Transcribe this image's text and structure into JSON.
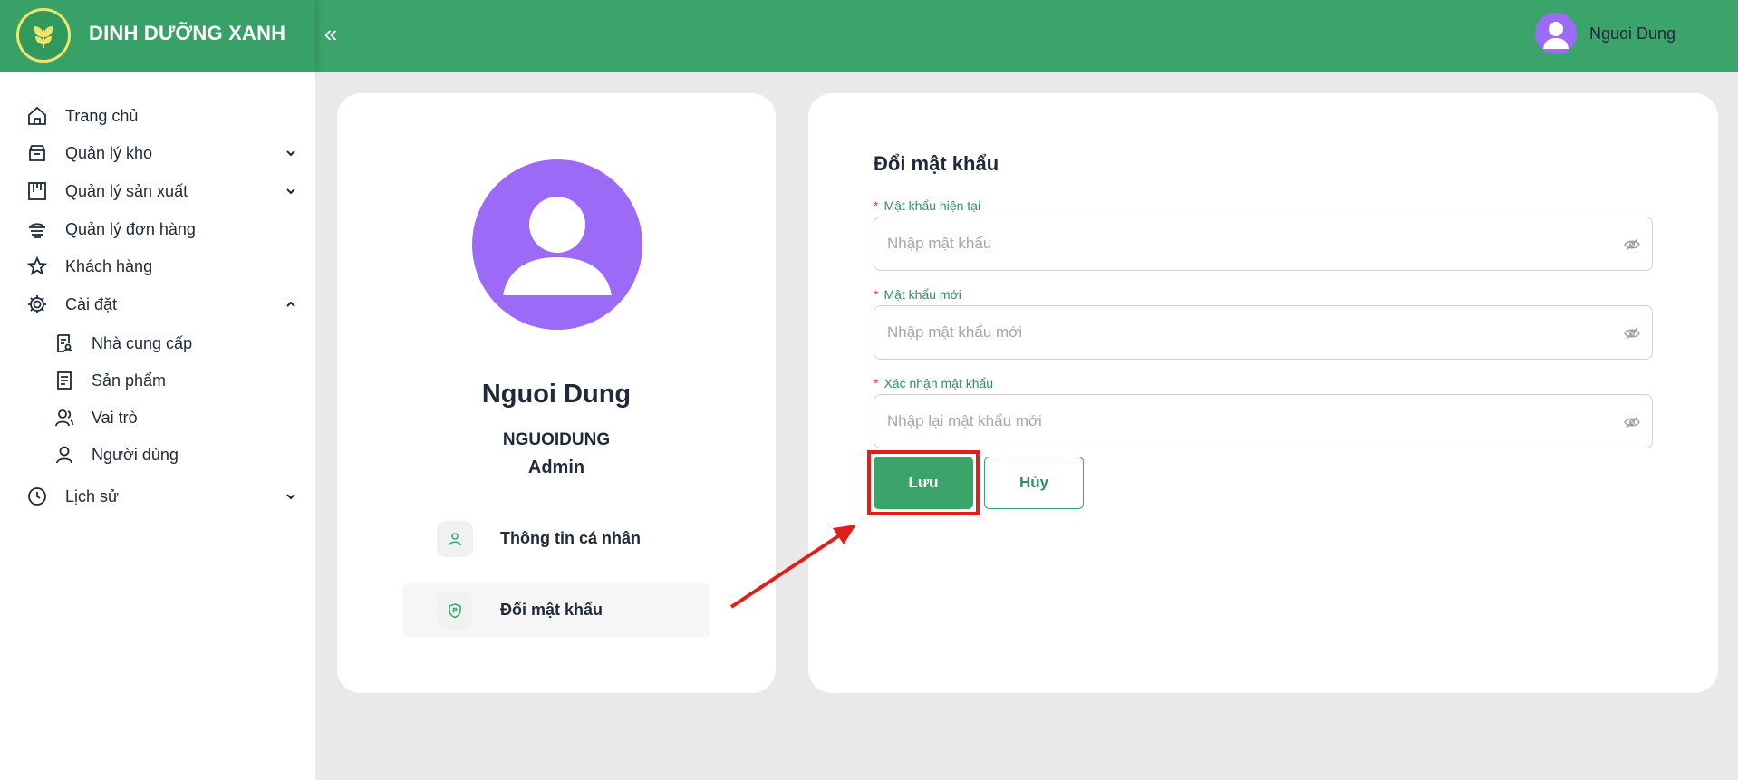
{
  "header": {
    "brand_name": "DINH DƯỠNG XANH",
    "collapse_glyph": "«",
    "user_name": "Nguoi Dung",
    "bg_color": "#3aa46a"
  },
  "sidebar": {
    "items": [
      {
        "label": "Trang chủ",
        "icon": "home-icon"
      },
      {
        "label": "Quản lý kho",
        "icon": "inventory-icon",
        "expanded": false
      },
      {
        "label": "Quản lý sản xuất",
        "icon": "production-icon",
        "expanded": false
      },
      {
        "label": "Quản lý đơn hàng",
        "icon": "orders-icon"
      },
      {
        "label": "Khách hàng",
        "icon": "star-icon"
      },
      {
        "label": "Cài đặt",
        "icon": "gear-icon",
        "expanded": true
      },
      {
        "label": "Nhà cung cấp",
        "icon": "supplier-icon"
      },
      {
        "label": "Sản phẩm",
        "icon": "product-icon"
      },
      {
        "label": "Vai trò",
        "icon": "role-icon"
      },
      {
        "label": "Người dùng",
        "icon": "user-icon"
      },
      {
        "label": "Lịch sử",
        "icon": "history-icon",
        "expanded": false
      }
    ]
  },
  "profile": {
    "display_name": "Nguoi Dung",
    "username": "NGUOIDUNG",
    "role": "Admin",
    "menu": [
      {
        "label": "Thông tin cá nhân",
        "icon": "person-icon",
        "active": false
      },
      {
        "label": "Đổi mật khẩu",
        "icon": "shield-icon",
        "active": true
      }
    ]
  },
  "change_password": {
    "title": "Đổi mật khẩu",
    "required_mark": "*",
    "fields": [
      {
        "label": "Mật khẩu hiện tại",
        "placeholder": "Nhập mật khẩu",
        "value": ""
      },
      {
        "label": "Mật khẩu mới",
        "placeholder": "Nhập mật khẩu mới",
        "value": ""
      },
      {
        "label": "Xác nhận mật khẩu",
        "placeholder": "Nhập lại mật khẩu mới",
        "value": ""
      }
    ],
    "save_label": "Lưu",
    "cancel_label": "Hủy"
  },
  "colors": {
    "accent": "#3aa46a",
    "avatar": "#9b6bf8",
    "annotation": "#e11d1d"
  }
}
